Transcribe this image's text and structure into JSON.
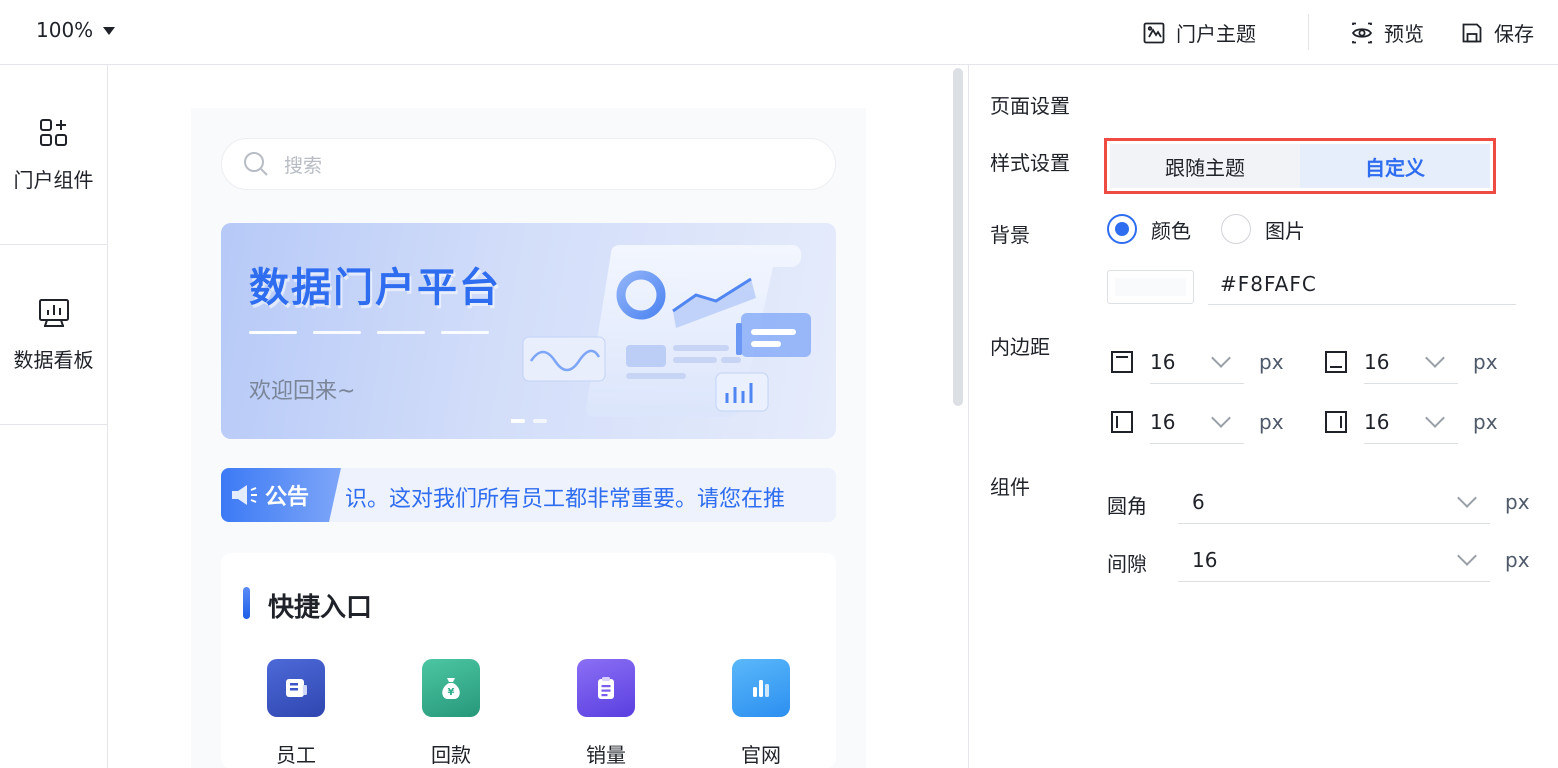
{
  "toolbar": {
    "zoom": "100%",
    "theme_label": "门户主题",
    "preview_label": "预览",
    "save_label": "保存"
  },
  "sidebar": {
    "items": [
      {
        "label": "门户组件",
        "icon": "grid-plus-icon"
      },
      {
        "label": "数据看板",
        "icon": "chart-board-icon"
      }
    ]
  },
  "canvas": {
    "search_placeholder": "搜索",
    "banner": {
      "title": "数据门户平台",
      "subtitle": "欢迎回来~"
    },
    "notice": {
      "tag": "公告",
      "text": "识。这对我们所有员工都非常重要。请您在推"
    },
    "quick_entry": {
      "title": "快捷入口",
      "items": [
        {
          "label": "员工",
          "icon": "staff-card-icon",
          "color": "#3b56c8"
        },
        {
          "label": "回款",
          "icon": "money-bag-icon",
          "color": "#2fae8c"
        },
        {
          "label": "销量",
          "icon": "clipboard-icon",
          "color": "#7b5cf0"
        },
        {
          "label": "官网",
          "icon": "bar-chart-icon",
          "color": "#3aa6f5"
        }
      ]
    }
  },
  "panel": {
    "page_settings": "页面设置",
    "style_settings": "样式设置",
    "style_options": [
      "跟随主题",
      "自定义"
    ],
    "style_selected": "自定义",
    "background": {
      "label": "背景",
      "options": [
        "颜色",
        "图片"
      ],
      "selected": "颜色",
      "color": "#F8FAFC"
    },
    "padding": {
      "label": "内边距",
      "top": "16",
      "bottom": "16",
      "left": "16",
      "right": "16",
      "unit": "px"
    },
    "component": {
      "label": "组件",
      "radius_label": "圆角",
      "radius": "6",
      "gap_label": "间隙",
      "gap": "16",
      "unit": "px"
    }
  },
  "colors": {
    "accent": "#2f6df0",
    "highlight_border": "#ee4b43"
  }
}
